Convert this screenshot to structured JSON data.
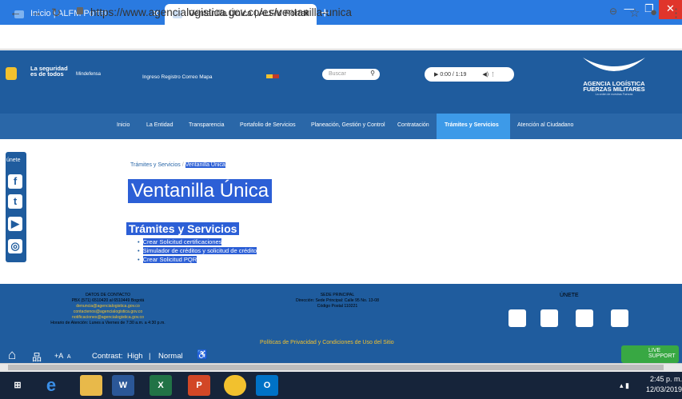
{
  "browser": {
    "tabs": [
      {
        "label": "Inicio | ALFM Portal",
        "active": false
      },
      {
        "label": "Ventanilla Única | ALFM Portal",
        "active": true
      }
    ],
    "url": "https://www.agencialogistica.gov.co/es/ventanilla-unica"
  },
  "header": {
    "gov_logo_line1": "La seguridad",
    "gov_logo_line2": "es de todos",
    "mindefensa": "Mindefensa",
    "top_links": [
      "Ingreso",
      "Registro",
      "Correo",
      "Mapa"
    ],
    "search_placeholder": "Buscar",
    "audio_time": "0:00 / 1:19",
    "brand_line1": "AGENCIA LOGÍSTICA",
    "brand_line2": "FUERZAS MILITARES",
    "brand_tagline": "La orden de nuestras Fuerzas"
  },
  "nav": {
    "items": [
      "Inicio",
      "La Entidad",
      "Transparencia",
      "Portafolio de Servicios",
      "Planeación, Gestión y Control",
      "Contratación",
      "Trámites y Servicios",
      "Atención al Ciudadano"
    ],
    "active": "Trámites y Servicios"
  },
  "social": {
    "label": "únete",
    "icons": [
      "facebook-icon",
      "twitter-icon",
      "youtube-icon",
      "instagram-icon"
    ]
  },
  "content": {
    "breadcrumb": [
      "Trámites y Servicios",
      "Ventanilla Única"
    ],
    "title": "Ventanilla Única",
    "section_title": "Trámites y Servicios",
    "links": [
      "Crear Solicitud certificaciones",
      "Simulador de créditos y solicitud de crédito",
      "Crear Solicitud PQR"
    ]
  },
  "footer": {
    "contact_title": "DATOS DE CONTACTO",
    "contact_lines": [
      "PBX (571) 6510420 al 6510449 Bogotá",
      "denuncia@agencialogistica.gov.co",
      "contactenos@agencialogistica.gov.co",
      "notificaciones@agencialogistica.gov.co",
      "Horario de Atención: Lunes a Viernes de 7:30 a.m. a 4:30 p.m."
    ],
    "sede_title": "SEDE PRINCIPAL",
    "sede_lines": [
      "Dirección: Sede Principal: Calle 95 No. 13-08",
      "Código Postal 110221"
    ],
    "unete": "ÚNETE",
    "policy": "Políticas de Privacidad y Condiciones de Uso del Sitio"
  },
  "accessibility": {
    "font_label": "A",
    "contrast": "Contrast:",
    "high": "High",
    "sep": "|",
    "normal": "Normal"
  },
  "chat": {
    "line1": "LIVE",
    "line2": "SUPPORT"
  },
  "taskbar": {
    "time": "2:45 p. m.",
    "date": "12/03/2019"
  },
  "colors": {
    "brand": "#1f5c9e",
    "nav": "#2a67a8",
    "active": "#3d9ae8",
    "selection": "#2c5fd6"
  }
}
